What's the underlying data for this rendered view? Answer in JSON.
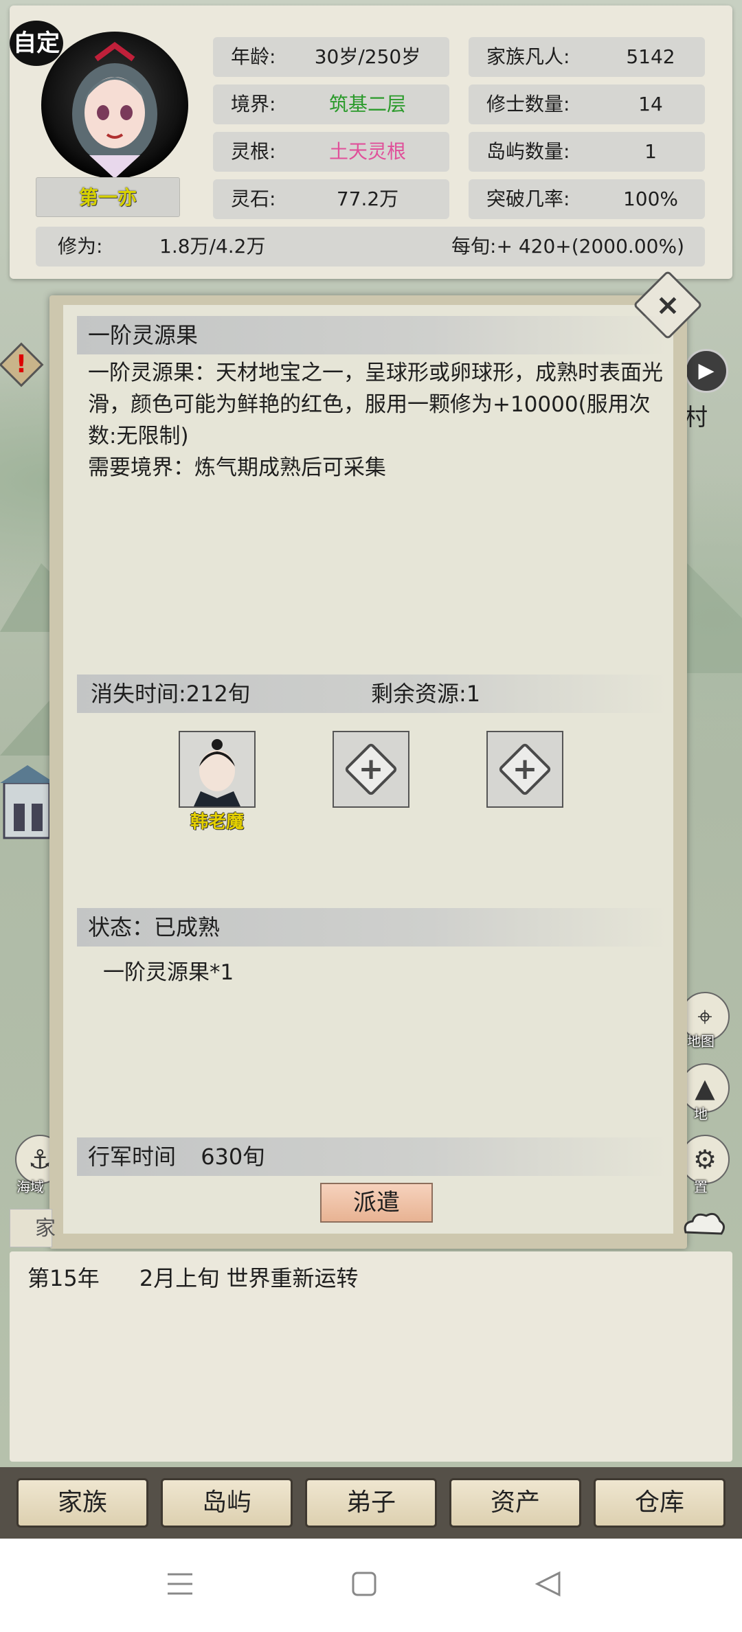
{
  "header": {
    "custom_badge": "自定",
    "character_name": "第一亦",
    "stats": {
      "age_label": "年龄:",
      "age_value": "30岁/250岁",
      "realm_label": "境界:",
      "realm_value": "筑基二层",
      "root_label": "灵根:",
      "root_value": "土天灵根",
      "stone_label": "灵石:",
      "stone_value": "77.2万",
      "family_label": "家族凡人:",
      "family_value": "5142",
      "cultivator_label": "修士数量:",
      "cultivator_value": "14",
      "island_label": "岛屿数量:",
      "island_value": "1",
      "breakthrough_label": "突破几率:",
      "breakthrough_value": "100%",
      "cultivation_label": "修为:",
      "cultivation_value": "1.8万/4.2万",
      "per_turn_label": "每旬:+ 420+(2000.00%)"
    },
    "colors": {
      "realm": "#2a9a2a",
      "root": "#e0509a"
    }
  },
  "side": {
    "alert_mark": "!",
    "right_text": "村",
    "map_label": "地图",
    "land_label": "地",
    "settings_label": "置",
    "sea_label": "海域",
    "log_tab": "家"
  },
  "dialog": {
    "title": "一阶灵源果",
    "description": "一阶灵源果：天材地宝之一，呈球形或卵球形，成熟时表面光滑，颜色可能为鲜艳的红色，服用一颗修为+10000(服用次数:无限制)",
    "requirement": "需要境界：炼气期成熟后可采集",
    "vanish_time": "消失时间:212旬",
    "remaining": "剩余资源:1",
    "hero_name": "韩老魔",
    "status": "状态：已成熟",
    "yield": "一阶灵源果*1",
    "march_label": "行军时间",
    "march_value": "630旬",
    "dispatch": "派遣"
  },
  "log": {
    "year": "第15年",
    "text": "2月上旬 世界重新运转"
  },
  "nav": {
    "items": [
      {
        "label": "家族"
      },
      {
        "label": "岛屿"
      },
      {
        "label": "弟子"
      },
      {
        "label": "资产"
      },
      {
        "label": "仓库"
      }
    ]
  }
}
